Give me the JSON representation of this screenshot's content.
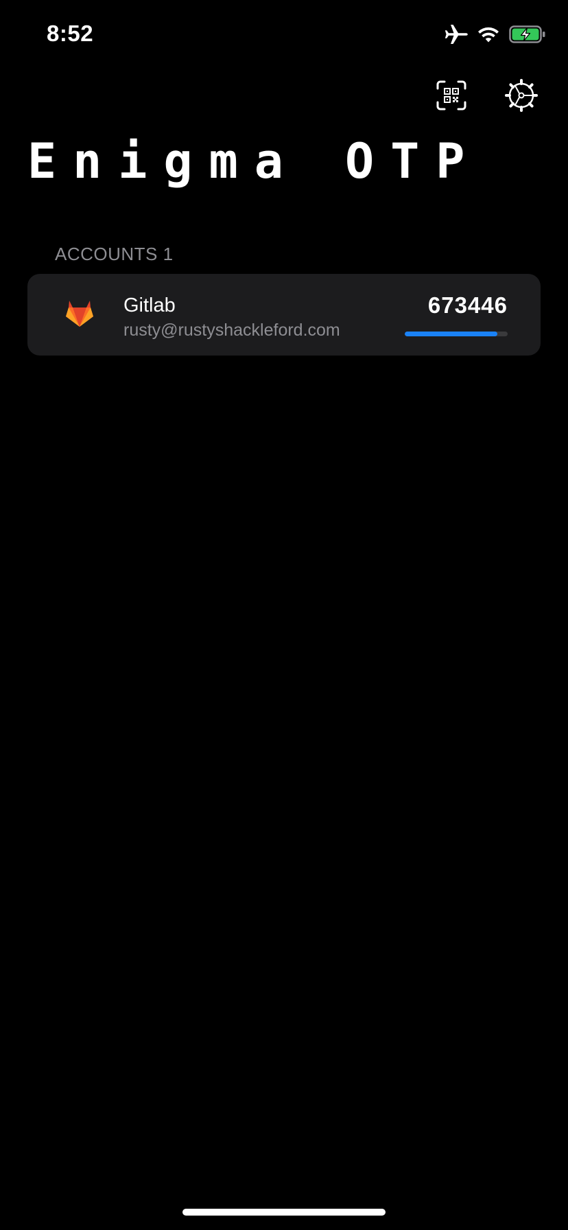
{
  "status_bar": {
    "time": "8:52",
    "icons": [
      "airplane-icon",
      "wifi-icon",
      "battery-charging-icon"
    ],
    "battery_color": "#34c759"
  },
  "toolbar": {
    "icons": [
      "qr-scan-icon",
      "gear-icon"
    ]
  },
  "app": {
    "title": "Enigma OTP"
  },
  "accounts": {
    "header": "ACCOUNTS 1",
    "items": [
      {
        "name": "Gitlab",
        "email": "rusty@rustyshackleford.com",
        "code": "673446",
        "logo_icon": "gitlab-icon",
        "progress": 0.9
      }
    ]
  },
  "colors": {
    "background": "#000000",
    "card": "#1c1c1e",
    "secondary_text": "#8e8e93",
    "accent": "#1a82f7"
  }
}
